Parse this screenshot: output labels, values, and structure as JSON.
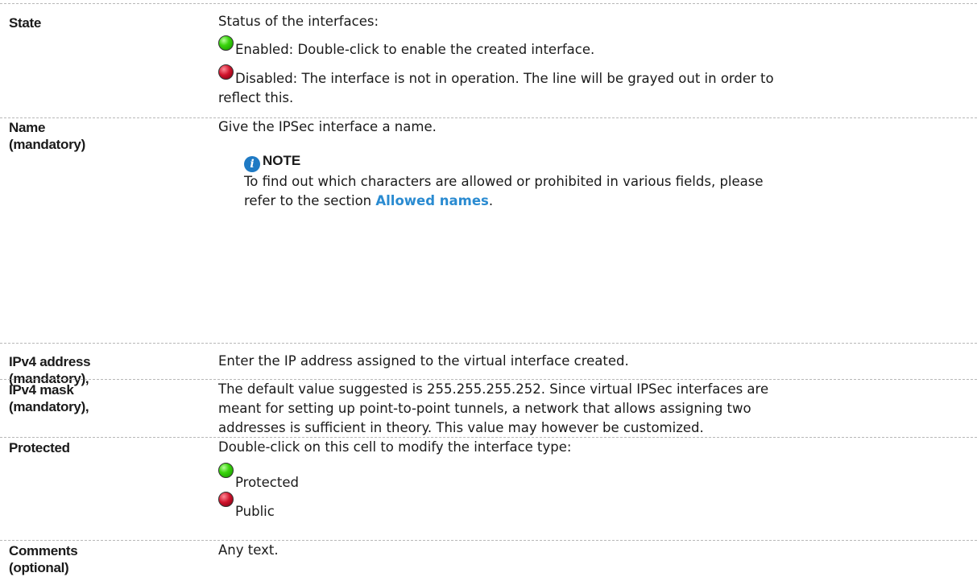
{
  "rows": [
    {
      "label": [
        "State"
      ],
      "desc_intro": "Status of the interfaces:",
      "enabled_text": "Enabled: Double-click to enable the created interface.",
      "disabled_text_1": "Disabled: The interface is not in operation. The line will be grayed out in order to",
      "disabled_text_2": "reflect this."
    },
    {
      "label": [
        "Name",
        "(mandatory)"
      ],
      "desc": "Give the IPSec interface a name.",
      "note_title": "NOTE",
      "note_line1": "To find out which characters are allowed or prohibited in various fields, please",
      "note_line2_pre": "refer to the section ",
      "note_link": "Allowed names",
      "note_line2_post": "."
    },
    {
      "label": [
        "IPv4 address",
        "(mandatory),"
      ],
      "desc": "Enter the IP address assigned to the virtual interface created."
    },
    {
      "label": [
        "IPv4 mask",
        "(mandatory),"
      ],
      "desc_lines": [
        "The default value suggested is 255.255.255.252. Since virtual IPSec interfaces are",
        "meant for setting up point-to-point tunnels, a network that allows assigning two",
        "addresses is sufficient in theory. This value may however be customized."
      ]
    },
    {
      "label": [
        "Protected"
      ],
      "desc": "Double-click on this cell to modify the interface type:",
      "option_protected": "Protected",
      "option_public": "Public"
    },
    {
      "label": [
        "Comments",
        "(optional)"
      ],
      "desc": "Any text."
    }
  ],
  "colors": {
    "link": "#2a8bd1",
    "info_icon": "#1f7ac4",
    "status_green": "#39d40c",
    "status_red": "#d0142c"
  },
  "icons": [
    "green-status-icon",
    "red-status-icon",
    "info-icon"
  ]
}
